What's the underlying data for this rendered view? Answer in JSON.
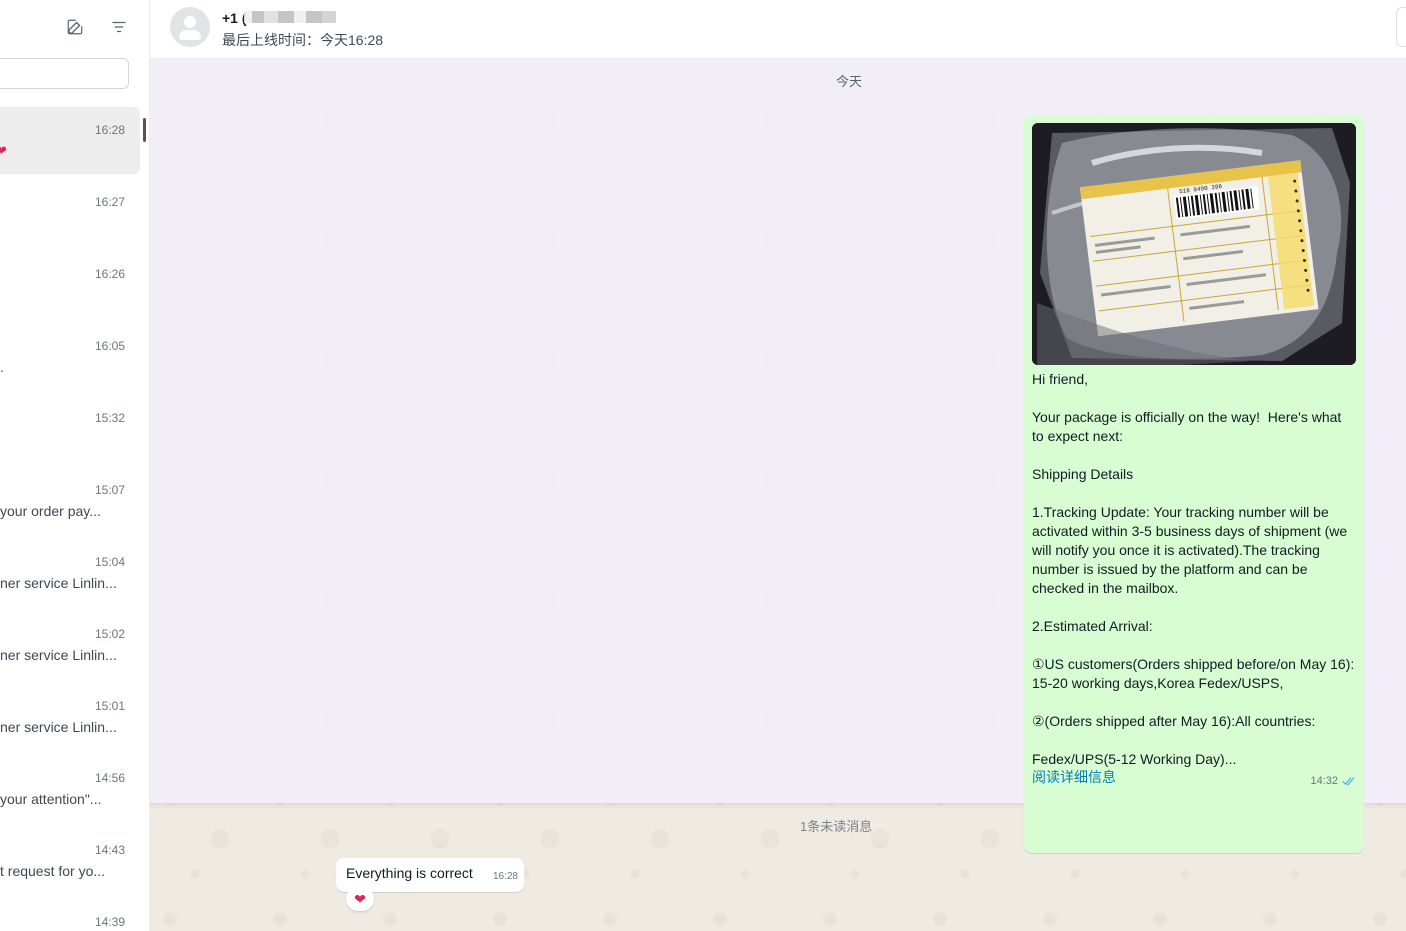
{
  "sidebar": {
    "chats": [
      {
        "time": "16:28",
        "preview": "",
        "reaction": "❤"
      },
      {
        "time": "16:27",
        "preview": ""
      },
      {
        "time": "16:26",
        "preview": ""
      },
      {
        "time": "16:05",
        "preview": "."
      },
      {
        "time": "15:32",
        "preview": ""
      },
      {
        "time": "15:07",
        "preview": "your order pay..."
      },
      {
        "time": "15:04",
        "preview": "ner service Linlin..."
      },
      {
        "time": "15:02",
        "preview": "ner service Linlin..."
      },
      {
        "time": "15:01",
        "preview": "ner service Linlin..."
      },
      {
        "time": "14:56",
        "preview": "your attention\"..."
      },
      {
        "time": "14:43",
        "preview": "t request for yo..."
      },
      {
        "time": "14:39",
        "preview": ""
      }
    ]
  },
  "header": {
    "contact_name": "+1 (",
    "last_seen": "最后上线时间：今天16:28"
  },
  "chat": {
    "day_label": "今天",
    "outgoing": {
      "text": "Hi friend,\n\nYour package is officially on the way!  Here's what to expect next:\n\nShipping Details\n\n1.Tracking Update: Your tracking number will be activated within 3-5 business days of shipment (we will notify you once it is activated).The tracking number is issued by the platform and can be checked in the mailbox.\n\n2.Estimated Arrival:\n\n①US customers(Orders shipped before/on May 16): 15-20 working days,Korea Fedex/USPS,\n\n②(Orders shipped after May 16):All countries:\n\nFedex/UPS(5-12 Working Day)...",
      "read_more": "阅读详细信息",
      "time": "14:32",
      "status_icon": "double-check-icon",
      "photo_label_number": "518 8490 398"
    },
    "unread_label": "1条未读消息",
    "incoming": {
      "text": "Everything is correct",
      "time": "16:28",
      "reaction": "❤"
    }
  },
  "colors": {
    "outgoing_bubble": "#d9fdd3",
    "link": "#027eb5",
    "read_tick": "#53bdeb",
    "reaction": "#e0245e"
  }
}
